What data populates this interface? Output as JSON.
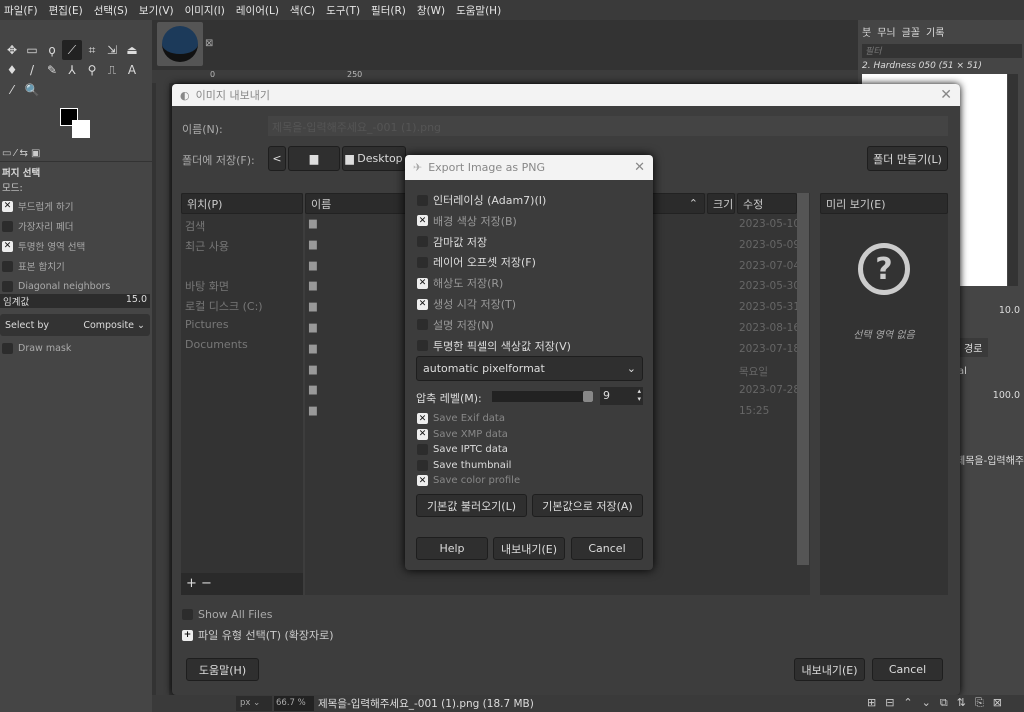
{
  "menu": [
    "파일(F)",
    "편집(E)",
    "선택(S)",
    "보기(V)",
    "이미지(I)",
    "레이어(L)",
    "색(C)",
    "도구(T)",
    "필터(R)",
    "창(W)",
    "도움말(H)"
  ],
  "toolbox": {
    "tools": [
      "✥",
      "▭",
      "ϙ",
      "⟋",
      "⌗",
      "⇲",
      "⏏",
      "♦",
      "/",
      "✎",
      "⅄",
      "⚲",
      "⎍",
      "A",
      "⁄",
      "🔍"
    ],
    "panel_title": "퍼지 선택",
    "mode_label": "모드:",
    "options": [
      {
        "label": "부드럽게 하기",
        "checked": true
      },
      {
        "label": "가장자리 페더",
        "checked": false
      },
      {
        "label": "투명한 영역 선택",
        "checked": true
      },
      {
        "label": "표본 합치기",
        "checked": false
      },
      {
        "label": "Diagonal neighbors",
        "checked": false
      }
    ],
    "threshold_label": "임계값",
    "threshold_value": "15.0",
    "select_by_label": "Select by",
    "select_by_value": "Composite",
    "draw_mask": "Draw mask"
  },
  "ruler": {
    "t0": "0",
    "t250": "250"
  },
  "export_dialog": {
    "title": "이미지 내보내기",
    "name_label": "이름(N):",
    "name_value": "제목을-입력해주세요_-001 (1).png",
    "folder_label": "폴더에 저장(F):",
    "crumb_desktop": "Desktop",
    "create_folder": "폴더 만들기(L)",
    "places_header": "위치(P)",
    "places": [
      "검색",
      "최근 사용",
      "",
      "바탕 화면",
      "로컬 디스크 (C:)",
      "Pictures",
      "Documents"
    ],
    "col_name": "이름",
    "col_size": "크기",
    "col_modified": "수정",
    "dates": [
      "2023-05-10",
      "2023-05-09",
      "2023-07-04",
      "2023-05-30",
      "2023-05-31",
      "2023-08-16",
      "2023-07-18",
      "목요일",
      "2023-07-28",
      "15:25"
    ],
    "preview_header": "미리 보기(E)",
    "preview_empty": "선택 영역 없음",
    "show_all_files": "Show All Files",
    "file_type": "파일 유형 선택(T) (확장자로)",
    "help": "도움말(H)",
    "export": "내보내기(E)",
    "cancel": "Cancel"
  },
  "png_dialog": {
    "title": "Export Image as PNG",
    "options": [
      {
        "label": "인터레이싱 (Adam7)(I)",
        "checked": false,
        "dim": false
      },
      {
        "label": "배경 색상 저장(B)",
        "checked": true,
        "dim": true
      },
      {
        "label": "감마값 저장",
        "checked": false,
        "dim": false
      },
      {
        "label": "레이어 오프셋 저장(F)",
        "checked": false,
        "dim": false
      },
      {
        "label": "해상도 저장(R)",
        "checked": true,
        "dim": true
      },
      {
        "label": "생성 시각 저장(T)",
        "checked": true,
        "dim": true
      },
      {
        "label": "설명 저장(N)",
        "checked": false,
        "dim": true
      },
      {
        "label": "투명한 픽셀의 색상값 저장(V)",
        "checked": false,
        "dim": false
      }
    ],
    "pixelformat": "automatic pixelformat",
    "compression_label": "압축 레벨(M):",
    "compression_value": "9",
    "compression_max": 9,
    "meta": [
      {
        "label": "Save Exif data",
        "checked": true,
        "dim": true
      },
      {
        "label": "Save XMP data",
        "checked": true,
        "dim": true
      },
      {
        "label": "Save IPTC data",
        "checked": false,
        "dim": false
      },
      {
        "label": "Save thumbnail",
        "checked": false,
        "dim": false
      },
      {
        "label": "Save color profile",
        "checked": true,
        "dim": true
      }
    ],
    "load_defaults": "기본값 불러오기(L)",
    "save_defaults": "기본값으로 저장(A)",
    "help": "Help",
    "export": "내보내기(E)",
    "cancel": "Cancel"
  },
  "right_panel": {
    "tabs": [
      "붓",
      "무늬",
      "글꼴",
      "기록"
    ],
    "filter_placeholder": "필터",
    "brush_name": "2. Hardness 050 (51 × 51)",
    "spacing": "10.0",
    "paths_tab": "경로",
    "mode_frag": "al",
    "opacity": "100.0",
    "layer_name": "제목을-입력해주"
  },
  "status": {
    "unit": "px",
    "zoom": "66.7 %",
    "file_info": "제목을-입력해주세요_-001 (1).png (18.7 MB)"
  }
}
